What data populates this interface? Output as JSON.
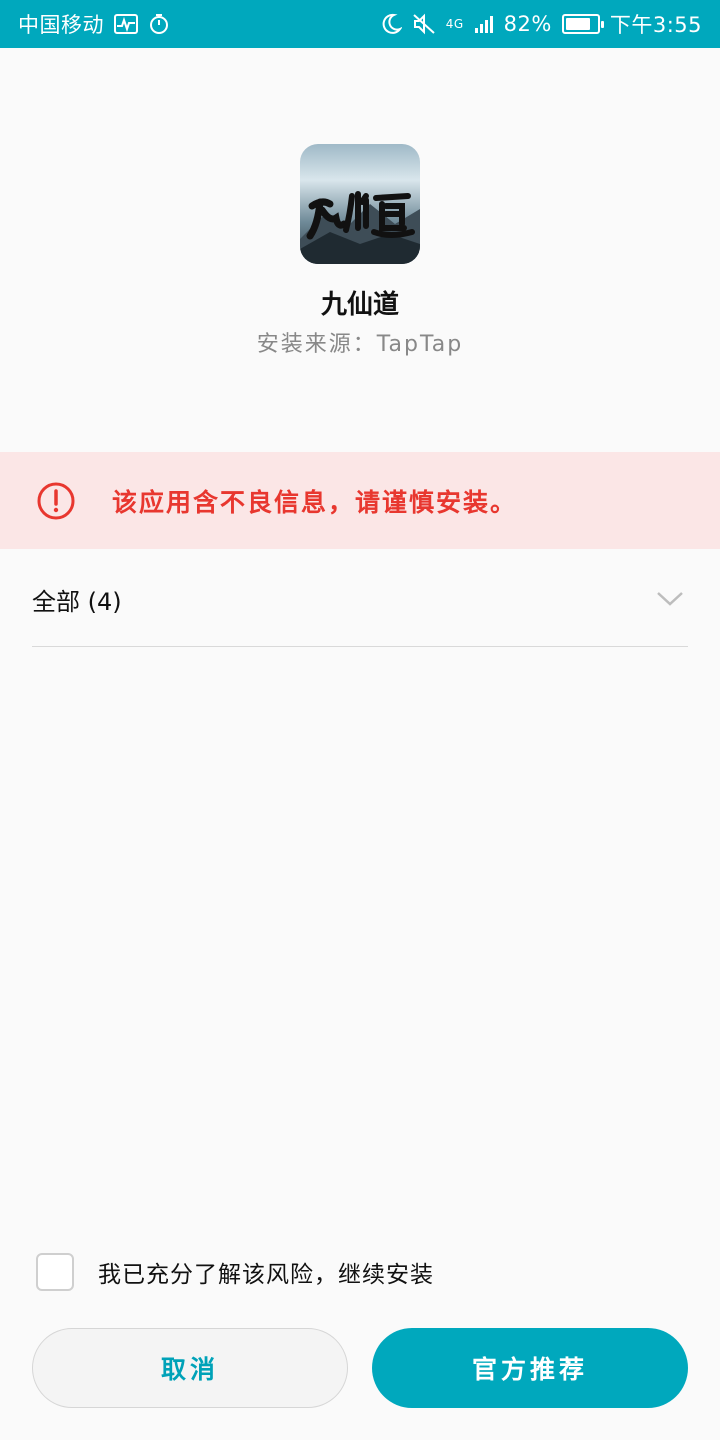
{
  "status_bar": {
    "carrier": "中国移动",
    "network": "4G",
    "battery_percent": "82%",
    "battery_level": 0.82,
    "time": "下午3:55",
    "background_color": "#00a8bd"
  },
  "app": {
    "icon_name": "app-icon-jiuxiandao",
    "name": "九仙道",
    "source": "安装来源：TapTap"
  },
  "warning": {
    "icon_name": "alert-circle-icon",
    "text": "该应用含不良信息，请谨慎安装。",
    "color": "#e8372f",
    "background_color": "#fbe6e6"
  },
  "filter": {
    "label": "全部 (4)",
    "icon_name": "chevron-down-icon"
  },
  "acknowledge": {
    "checked": false,
    "text": "我已充分了解该风险，继续安装"
  },
  "buttons": {
    "cancel_label": "取消",
    "official_label": "官方推荐",
    "accent_color": "#00a8bd"
  }
}
